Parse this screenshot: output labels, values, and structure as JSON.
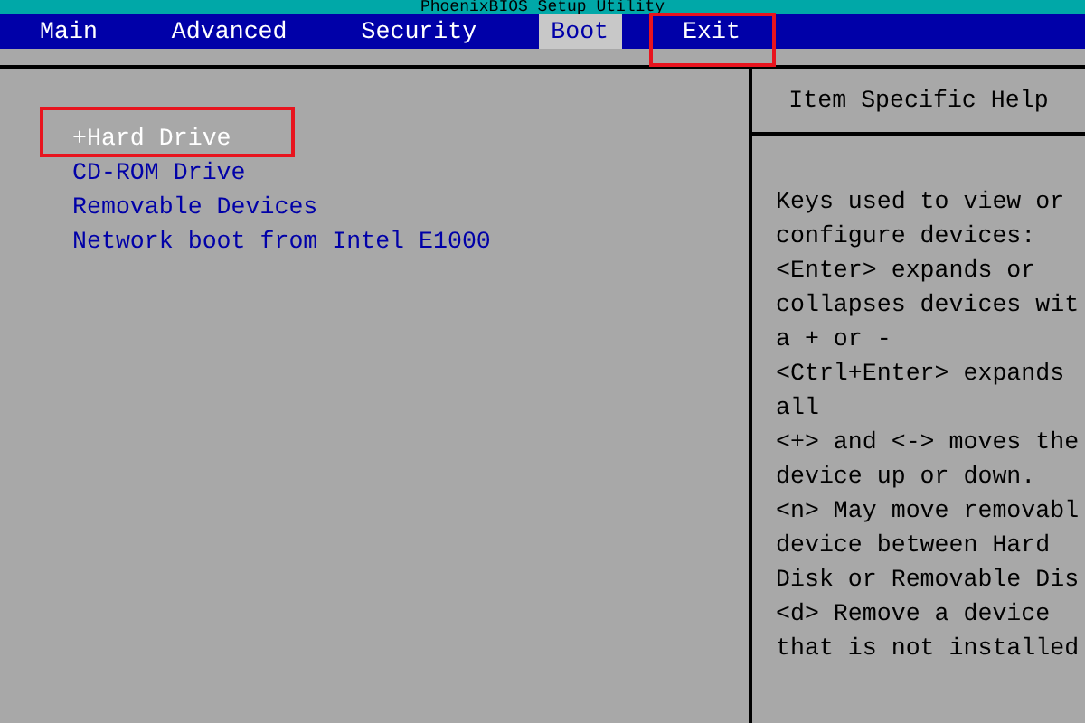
{
  "window": {
    "title": "PhoenixBIOS Setup Utility"
  },
  "tabs": [
    {
      "label": "Main",
      "selected": false,
      "highlighted": false
    },
    {
      "label": "Advanced",
      "selected": false,
      "highlighted": false
    },
    {
      "label": "Security",
      "selected": false,
      "highlighted": false
    },
    {
      "label": "Boot",
      "selected": true,
      "highlighted": false
    },
    {
      "label": "Exit",
      "selected": false,
      "highlighted": true
    }
  ],
  "boot_items": [
    {
      "label": "+Hard Drive",
      "selected": true,
      "highlighted": true
    },
    {
      "label": "CD-ROM Drive",
      "selected": false,
      "highlighted": false
    },
    {
      "label": "Removable Devices",
      "selected": false,
      "highlighted": false
    },
    {
      "label": "Network boot from Intel E1000",
      "selected": false,
      "highlighted": false
    }
  ],
  "help": {
    "title": "Item Specific Help",
    "lines": [
      "Keys used to view or",
      "configure devices:",
      "<Enter> expands or",
      "collapses devices wit",
      "a + or -",
      "<Ctrl+Enter> expands",
      "all",
      "<+> and <-> moves the",
      "device up or down.",
      "<n> May move removabl",
      "device between Hard",
      "Disk or Removable Dis",
      "<d> Remove a device",
      "that is not installed"
    ]
  }
}
